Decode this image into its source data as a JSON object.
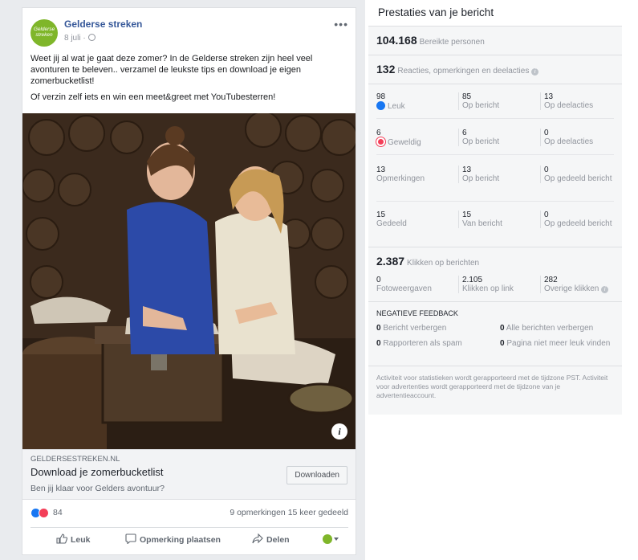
{
  "post": {
    "page_name": "Gelderse streken",
    "avatar_text": "Gelderse streken",
    "date": "8 juli ·",
    "more": "•••",
    "text_1": "Weet jij al wat je gaat deze zomer? In de Gelderse streken zijn heel veel avonturen te beleven.. verzamel de leukste tips en download je eigen zomerbucketlist!",
    "text_2": "Of verzin zelf iets en win een meet&greet met YouTubesterren!",
    "info_icon": "i",
    "link": {
      "domain": "GELDERSESTREKEN.NL",
      "title": "Download je zomerbucketlist",
      "description": "Ben jij klaar voor Gelders avontuur?",
      "cta": "Downloaden"
    },
    "reactions_count": "84",
    "comments_shares": "9 opmerkingen  15 keer gedeeld",
    "actions": {
      "like": "Leuk",
      "comment": "Opmerking plaatsen",
      "share": "Delen"
    }
  },
  "stats": {
    "title": "Prestaties van je bericht",
    "reach_value": "104.168",
    "reach_label": "Bereikte personen",
    "engagement_value": "132",
    "engagement_label": "Reacties, opmerkingen en deelacties",
    "rows": [
      {
        "a_num": "98",
        "a_label": "Leuk",
        "b_num": "85",
        "b_label": "Op bericht",
        "c_num": "13",
        "c_label": "Op deelacties"
      },
      {
        "a_num": "6",
        "a_label": "Geweldig",
        "b_num": "6",
        "b_label": "Op bericht",
        "c_num": "0",
        "c_label": "Op deelacties"
      },
      {
        "a_num": "13",
        "a_label": "Opmerkingen",
        "b_num": "13",
        "b_label": "Op bericht",
        "c_num": "0",
        "c_label": "Op gedeeld bericht"
      },
      {
        "a_num": "15",
        "a_label": "Gedeeld",
        "b_num": "15",
        "b_label": "Van bericht",
        "c_num": "0",
        "c_label": "Op gedeeld bericht"
      }
    ],
    "clicks_value": "2.387",
    "clicks_label": "Klikken op berichten",
    "clicks": [
      {
        "num": "0",
        "label": "Fotoweergaven"
      },
      {
        "num": "2.105",
        "label": "Klikken op link"
      },
      {
        "num": "282",
        "label": "Overige klikken"
      }
    ],
    "negative_title": "NEGATIEVE FEEDBACK",
    "negative": [
      {
        "num": "0",
        "label": "Bericht verbergen"
      },
      {
        "num": "0",
        "label": "Alle berichten verbergen"
      },
      {
        "num": "0",
        "label": "Rapporteren als spam"
      },
      {
        "num": "0",
        "label": "Pagina niet meer leuk vinden"
      }
    ],
    "footnote": "Activiteit voor statistieken wordt gerapporteerd met de tijdzone PST. Activiteit voor advertenties wordt gerapporteerd met de tijdzone van je advertentieaccount."
  }
}
